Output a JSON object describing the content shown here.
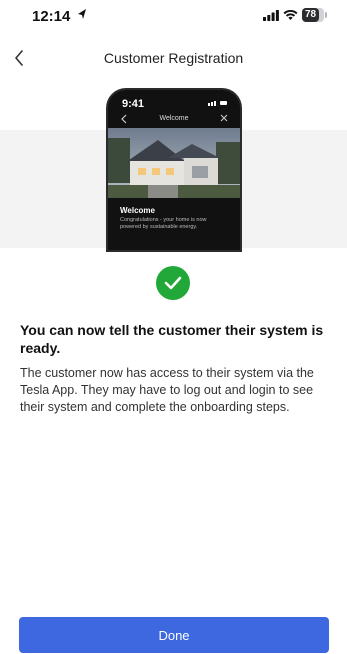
{
  "status_bar": {
    "time": "12:14",
    "battery": "78",
    "battery_level": 0.78
  },
  "nav": {
    "title": "Customer Registration"
  },
  "phone_preview": {
    "time": "9:41",
    "screen_title": "Welcome",
    "heading": "Welcome",
    "subtext": "Congratulations - your home is now powered by sustainable energy."
  },
  "content": {
    "headline": "You can now tell the customer their system is ready.",
    "body": "The customer now has access to their system via the Tesla App. They may have to log out and login to see their system and complete the onboarding steps."
  },
  "actions": {
    "done_label": "Done"
  },
  "colors": {
    "accent": "#3e68e0",
    "success": "#22a838"
  }
}
